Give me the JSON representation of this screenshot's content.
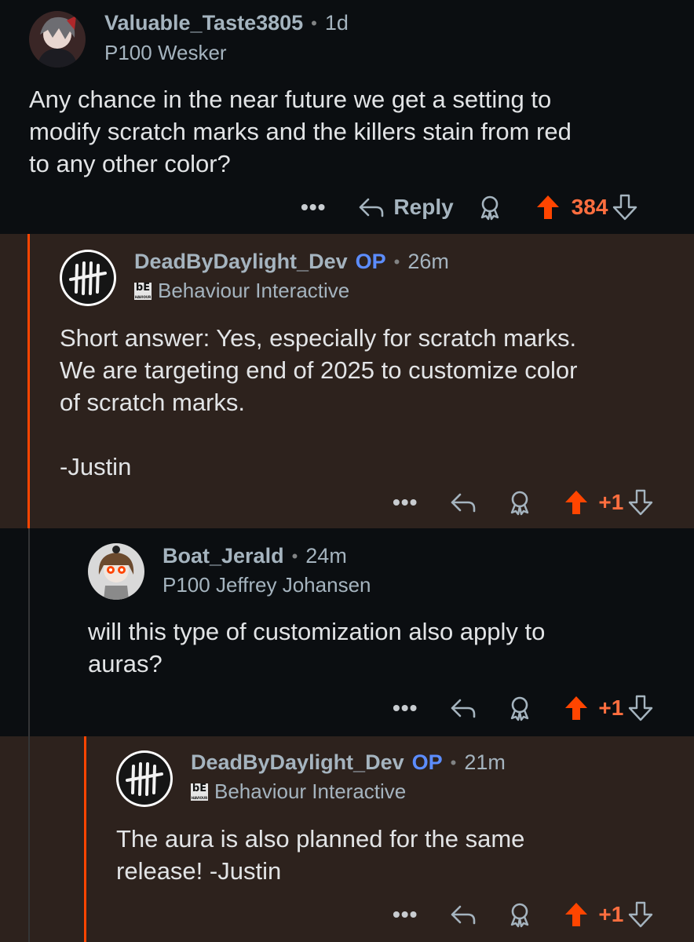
{
  "comments": [
    {
      "username": "Valuable_Taste3805",
      "op": "",
      "time": "1d",
      "flair": "P100 Wesker",
      "body": "Any chance in the near future we get a setting to\nmodify scratch marks and the killers stain from red\nto any other color?",
      "reply_label": "Reply",
      "score": "384"
    },
    {
      "username": "DeadByDaylight_Dev",
      "op": "OP",
      "time": "26m",
      "flair": "Behaviour Interactive",
      "flair_logo": "bE",
      "flair_logo_sub": "HAVIOUR",
      "body": "Short answer: Yes, especially for scratch marks.\nWe are targeting end of 2025 to customize color\nof scratch marks.\n\n-Justin",
      "score": "+1"
    },
    {
      "username": "Boat_Jerald",
      "op": "",
      "time": "24m",
      "flair": "P100 Jeffrey Johansen",
      "body": "will this type of customization also apply to\nauras?",
      "score": "+1"
    },
    {
      "username": "DeadByDaylight_Dev",
      "op": "OP",
      "time": "21m",
      "flair": "Behaviour Interactive",
      "flair_logo": "bE",
      "flair_logo_sub": "HAVIOUR",
      "body": "The aura is also planned for the same\nrelease! -Justin",
      "score": "+1"
    }
  ],
  "separator": "•",
  "more_label": "•••",
  "colors": {
    "background": "#0b0e11",
    "op_highlight": "#2d221d",
    "accent": "#ff4500",
    "op_badge": "#5c8dff",
    "upvoted": "#ff6e3f"
  },
  "icons": [
    "more-icon",
    "reply-icon",
    "award-icon",
    "upvote-icon",
    "downvote-icon"
  ]
}
